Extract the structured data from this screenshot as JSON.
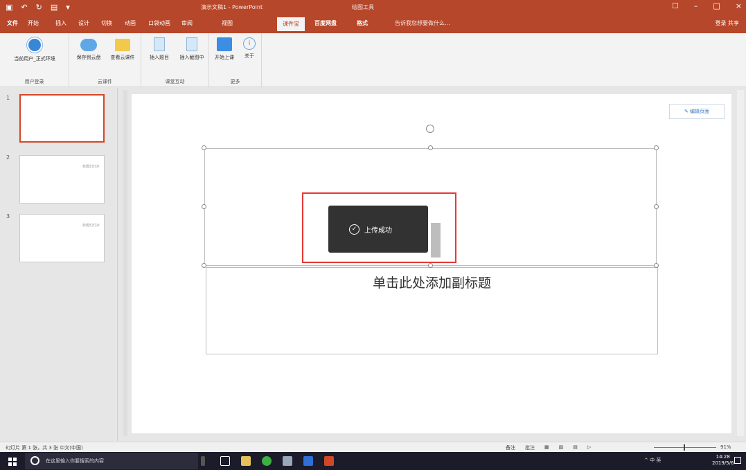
{
  "window": {
    "title": "演示文稿1 - PowerPoint",
    "context_tab": "绘图工具",
    "controls": [
      "☐",
      "–",
      "□",
      "×"
    ]
  },
  "tabs": {
    "file": "文件",
    "home": "开始",
    "insert": "插入",
    "design": "设计",
    "transitions": "切换",
    "animations": "动画",
    "ppt_live": "口袋动画",
    "review": "审阅",
    "view": "视图",
    "active": "课件宝",
    "extra": "百度网盘",
    "format": "格式",
    "tell_me": "告诉我您想要做什么...",
    "signin": "登录  共享"
  },
  "ribbon": {
    "user_btn": "当前用户_正式环境",
    "cloud_sync_btn": "保存到云盘",
    "cloud_folder_btn": "查看云课件",
    "insert_q_btn": "插入题目",
    "insert_qb_btn": "插入截图中",
    "start_btn": "开始上课",
    "about_btn": "关于",
    "group_user": "用户登录",
    "group_cloud": "云课件",
    "group_interact": "课堂互动",
    "group_more": "更多"
  },
  "slides": [
    {
      "num": "1",
      "mini": ""
    },
    {
      "num": "2",
      "mini": "标题幻灯片"
    },
    {
      "num": "3",
      "mini": "标题幻灯片"
    }
  ],
  "slide": {
    "edit_button": "编辑页面",
    "subtitle": "单击此处添加副标题"
  },
  "toast": {
    "check": "✓",
    "message": "上传成功"
  },
  "status": {
    "left": "幻灯片 第 1 张，共 3 张   中文(中国)",
    "notes": "备注",
    "comments": "批注",
    "zoom": "91%"
  },
  "taskbar": {
    "search_placeholder": "在这里输入你要搜索的内容",
    "tray": "^ 中 英",
    "time": "14:28",
    "date": "2019/5/6"
  },
  "colors": {
    "ppt_accent": "#b7472a",
    "toast_bg": "#323232",
    "highlight_red": "#e53935"
  }
}
